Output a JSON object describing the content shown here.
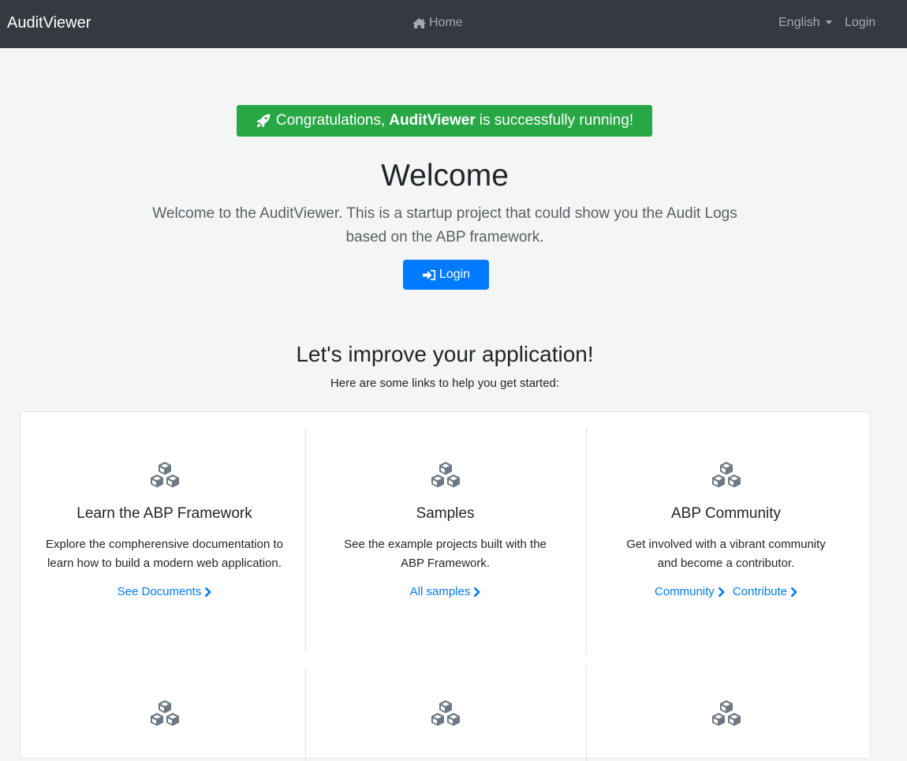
{
  "navbar": {
    "brand": "AuditViewer",
    "home_label": "Home",
    "language_label": "English",
    "login_label": "Login"
  },
  "hero": {
    "congrats_prefix": "Congratulations,",
    "congrats_app": "AuditViewer",
    "congrats_suffix": "is successfully running!",
    "title": "Welcome",
    "description": "Welcome to the AuditViewer. This is a startup project that could show you the Audit Logs based on the ABP framework.",
    "login_button": "Login"
  },
  "improve": {
    "title": "Let's improve your application!",
    "subtitle": "Here are some links to help you get started:"
  },
  "features": [
    {
      "icon": "cubes-icon",
      "title": "Learn the ABP Framework",
      "description": "Explore the compherensive documentation to learn how to build a modern web application.",
      "links": [
        "See Documents"
      ]
    },
    {
      "icon": "cubes-icon",
      "title": "Samples",
      "description": "See the example projects built with the ABP Framework.",
      "links": [
        "All samples"
      ]
    },
    {
      "icon": "cubes-icon",
      "title": "ABP Community",
      "description": "Get involved with a vibrant community and become a contributor.",
      "links": [
        "Community",
        "Contribute"
      ]
    }
  ],
  "colors": {
    "navbar_bg": "#343a40",
    "success": "#28a745",
    "primary": "#007bff",
    "page_bg": "#f4f6f5",
    "icon_gray": "#6c7883"
  }
}
